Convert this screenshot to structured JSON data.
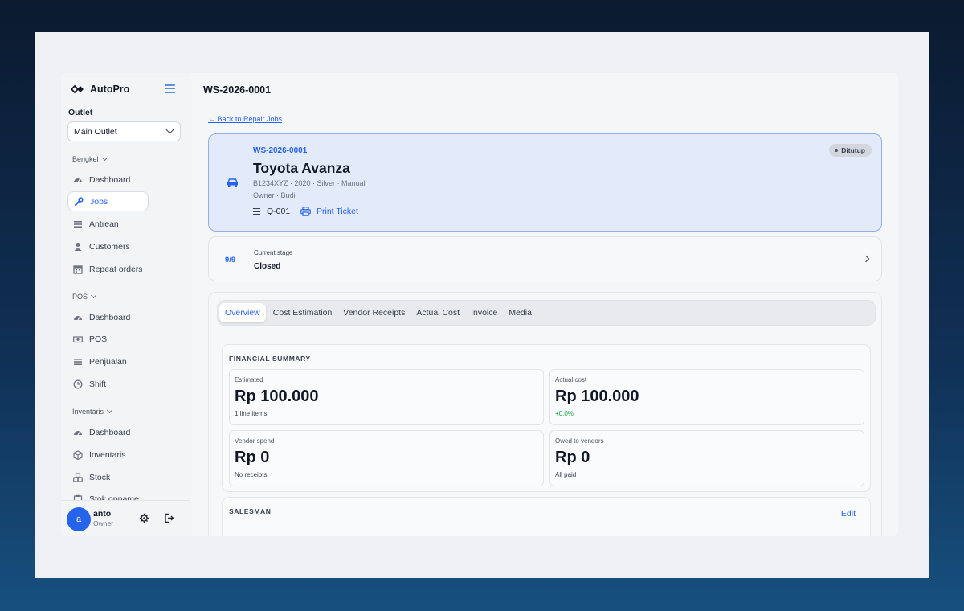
{
  "app": {
    "brand": "AutoPro"
  },
  "sidebar": {
    "outlet_label": "Outlet",
    "outlet_value": "Main Outlet",
    "sections": [
      {
        "label": "Bengkel",
        "items": [
          "Dashboard",
          "Jobs",
          "Antrean",
          "Customers",
          "Repeat orders"
        ]
      },
      {
        "label": "POS",
        "items": [
          "Dashboard",
          "POS",
          "Penjualan",
          "Shift"
        ]
      },
      {
        "label": "Inventaris",
        "items": [
          "Dashboard",
          "Inventaris",
          "Stock",
          "Stok opname"
        ]
      }
    ],
    "active_item": "Jobs",
    "icons": {
      "Bengkel": [
        "gauge-icon",
        "wrench-icon",
        "list-icon",
        "user-icon",
        "calendar-icon"
      ],
      "POS": [
        "gauge-icon",
        "cash-icon",
        "list-icon",
        "clock-icon"
      ],
      "Inventaris": [
        "gauge-icon",
        "box-icon",
        "boxes-icon",
        "clipboard-icon"
      ]
    }
  },
  "user": {
    "initial": "a",
    "name": "anto",
    "role": "Owner"
  },
  "header": {
    "title": "WS-2026-0001"
  },
  "back_link": "← Back to Repair Jobs",
  "job": {
    "code": "WS-2026-0001",
    "title": "Toyota Avanza",
    "meta": "B1234XYZ · 2020 · Silver · Manual",
    "owner": "Owner · Budi",
    "queue": "Q-001",
    "print_label": "Print Ticket",
    "status": "Ditutup"
  },
  "stage": {
    "progress": "9/9",
    "label": "Current stage",
    "value": "Closed"
  },
  "tabs": [
    "Overview",
    "Cost Estimation",
    "Vendor Receipts",
    "Actual Cost",
    "Invoice",
    "Media"
  ],
  "active_tab": "Overview",
  "financial": {
    "title": "FINANCIAL SUMMARY",
    "stats": [
      {
        "label": "Estimated",
        "value": "Rp 100.000",
        "sub": "1 line items",
        "sub_color": "default"
      },
      {
        "label": "Actual cost",
        "value": "Rp 100.000",
        "sub": "+0.0%",
        "sub_color": "green"
      },
      {
        "label": "Vendor spend",
        "value": "Rp 0",
        "sub": "No receipts",
        "sub_color": "default"
      },
      {
        "label": "Owed to vendors",
        "value": "Rp 0",
        "sub": "All paid",
        "sub_color": "default"
      }
    ]
  },
  "salesman": {
    "title": "SALESMAN",
    "edit_label": "Edit"
  },
  "colors": {
    "accent": "#2563eb",
    "success": "#16a34a",
    "card_highlight": "#e3eafa"
  }
}
